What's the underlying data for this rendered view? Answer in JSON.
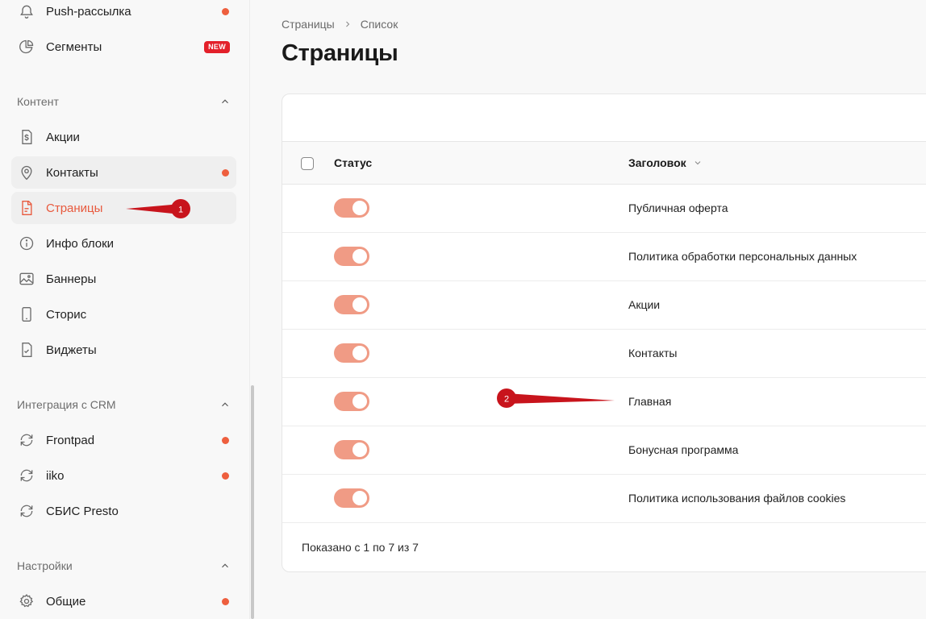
{
  "sidebar": {
    "top_items": [
      {
        "label": "Push-рассылка",
        "icon": "bell-icon",
        "dot": true
      },
      {
        "label": "Сегменты",
        "icon": "pie-chart-icon",
        "badge": "NEW"
      }
    ],
    "sections": [
      {
        "title": "Контент",
        "items": [
          {
            "label": "Акции",
            "icon": "dollar-document-icon"
          },
          {
            "label": "Контакты",
            "icon": "map-pin-icon",
            "dot": true
          },
          {
            "label": "Страницы",
            "icon": "page-icon",
            "active": true
          },
          {
            "label": "Инфо блоки",
            "icon": "info-icon"
          },
          {
            "label": "Баннеры",
            "icon": "image-icon"
          },
          {
            "label": "Сторис",
            "icon": "phone-icon"
          },
          {
            "label": "Виджеты",
            "icon": "checked-document-icon"
          }
        ]
      },
      {
        "title": "Интеграция с CRM",
        "items": [
          {
            "label": "Frontpad",
            "icon": "sync-icon",
            "dot": true
          },
          {
            "label": "iiko",
            "icon": "sync-icon",
            "dot": true
          },
          {
            "label": "СБИС Presto",
            "icon": "sync-icon"
          }
        ]
      },
      {
        "title": "Настройки",
        "items": [
          {
            "label": "Общие",
            "icon": "gear-icon",
            "dot": true
          }
        ]
      }
    ]
  },
  "breadcrumb": [
    "Страницы",
    "Список"
  ],
  "page_title": "Страницы",
  "table": {
    "columns": {
      "status": "Статус",
      "title": "Заголовок"
    },
    "rows": [
      {
        "enabled": true,
        "title": "Публичная оферта"
      },
      {
        "enabled": true,
        "title": "Политика обработки персональных данных"
      },
      {
        "enabled": true,
        "title": "Акции"
      },
      {
        "enabled": true,
        "title": "Контакты"
      },
      {
        "enabled": true,
        "title": "Главная"
      },
      {
        "enabled": true,
        "title": "Бонусная программа"
      },
      {
        "enabled": true,
        "title": "Политика использования файлов cookies"
      }
    ],
    "footer": "Показано с 1 по 7 из 7"
  },
  "annotations": [
    {
      "number": "1"
    },
    {
      "number": "2"
    }
  ],
  "colors": {
    "accent": "#e8593d",
    "toggle_on": "#f09b85",
    "status_dot": "#ee5f3e",
    "annotation": "#c8141c"
  }
}
